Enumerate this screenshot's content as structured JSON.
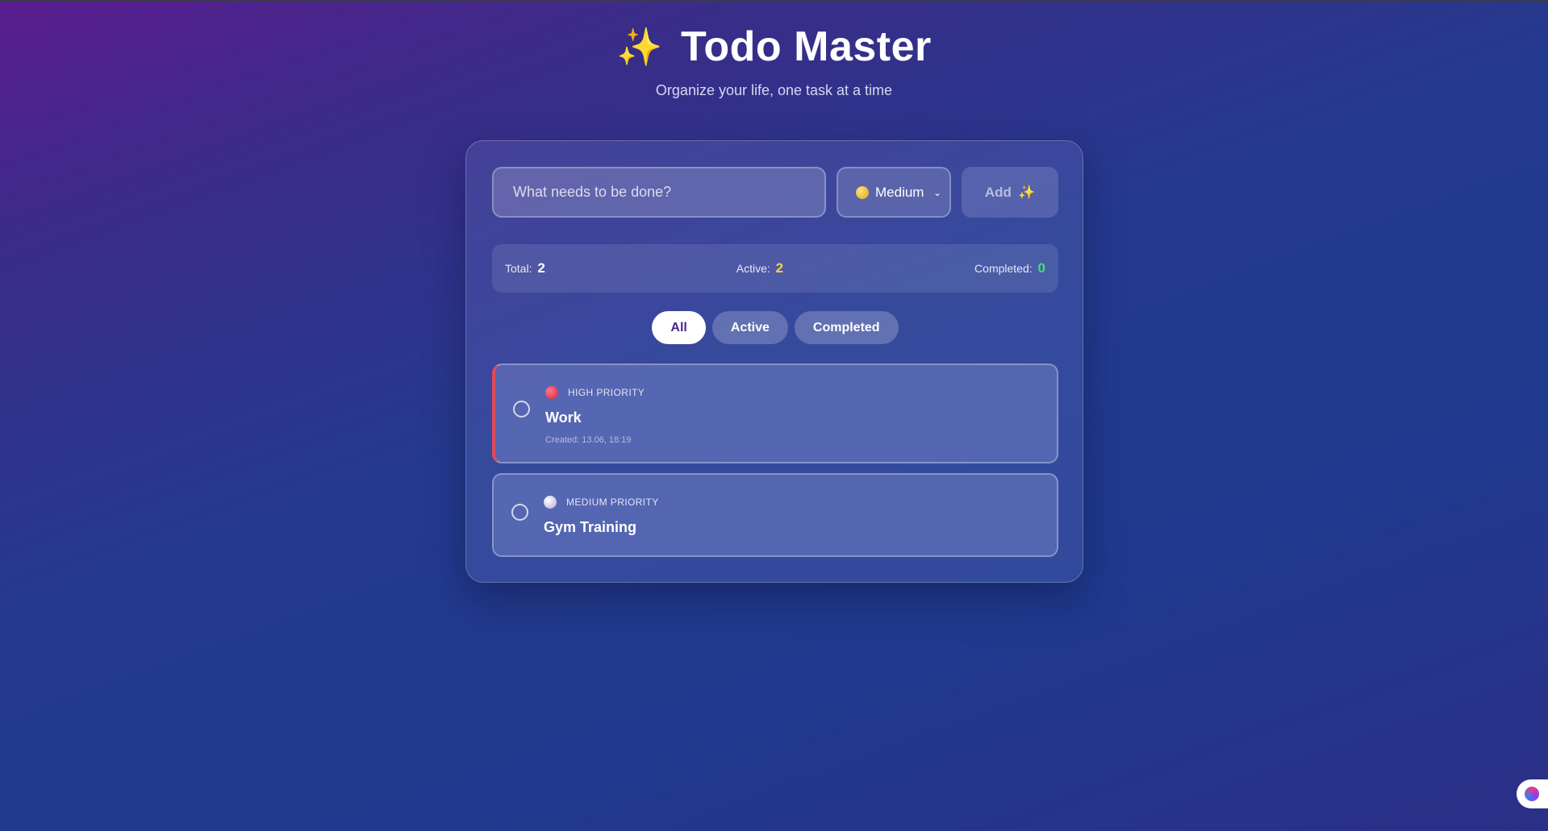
{
  "app": {
    "title": "Todo Master",
    "title_icon": "sparkles-icon",
    "subtitle": "Organize your life, one task at a time"
  },
  "new_todo": {
    "placeholder": "What needs to be done?",
    "value": "",
    "priority_selected": "Medium",
    "priority_icon": "yellow-circle-icon",
    "add_label": "Add",
    "add_icon": "sparkles-icon"
  },
  "stats": {
    "total_label": "Total:",
    "total_value": "2",
    "active_label": "Active:",
    "active_value": "2",
    "completed_label": "Completed:",
    "completed_value": "0"
  },
  "filters": [
    {
      "label": "All",
      "selected": true
    },
    {
      "label": "Active",
      "selected": false
    },
    {
      "label": "Completed",
      "selected": false
    }
  ],
  "todos": [
    {
      "priority_label": "HIGH PRIORITY",
      "priority_color": "#e24a5a",
      "title": "Work",
      "created": "Created: 13.06, 18:19",
      "completed": false
    },
    {
      "priority_label": "MEDIUM PRIORITY",
      "priority_color": "#c9b8e8",
      "title": "Gym Training",
      "completed": false
    }
  ],
  "colors": {
    "accent": "#4b2b8e",
    "active_count": "#ffd43b",
    "completed_count": "#3ee07a",
    "high_priority": "#e24a5a"
  }
}
